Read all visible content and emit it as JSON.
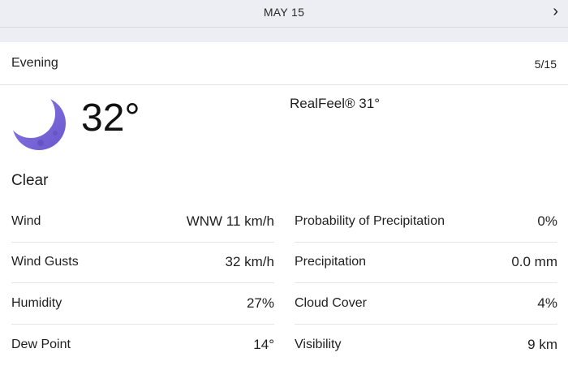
{
  "topbar": {
    "date": "MAY 15",
    "next_icon": "chevron-right-icon"
  },
  "header": {
    "period": "Evening",
    "short_date": "5/15"
  },
  "current": {
    "temperature": "32°",
    "realfeel": "RealFeel® 31°",
    "condition": "Clear",
    "icon": "moon-icon",
    "icon_color": "#7b68d8"
  },
  "details": {
    "left": [
      {
        "label": "Wind",
        "value": "WNW 11 km/h"
      },
      {
        "label": "Wind Gusts",
        "value": "32 km/h"
      },
      {
        "label": "Humidity",
        "value": "27%"
      },
      {
        "label": "Dew Point",
        "value": "14°"
      }
    ],
    "right": [
      {
        "label": "Probability of Precipitation",
        "value": "0%"
      },
      {
        "label": "Precipitation",
        "value": "0.0 mm"
      },
      {
        "label": "Cloud Cover",
        "value": "4%"
      },
      {
        "label": "Visibility",
        "value": "9 km"
      }
    ]
  }
}
